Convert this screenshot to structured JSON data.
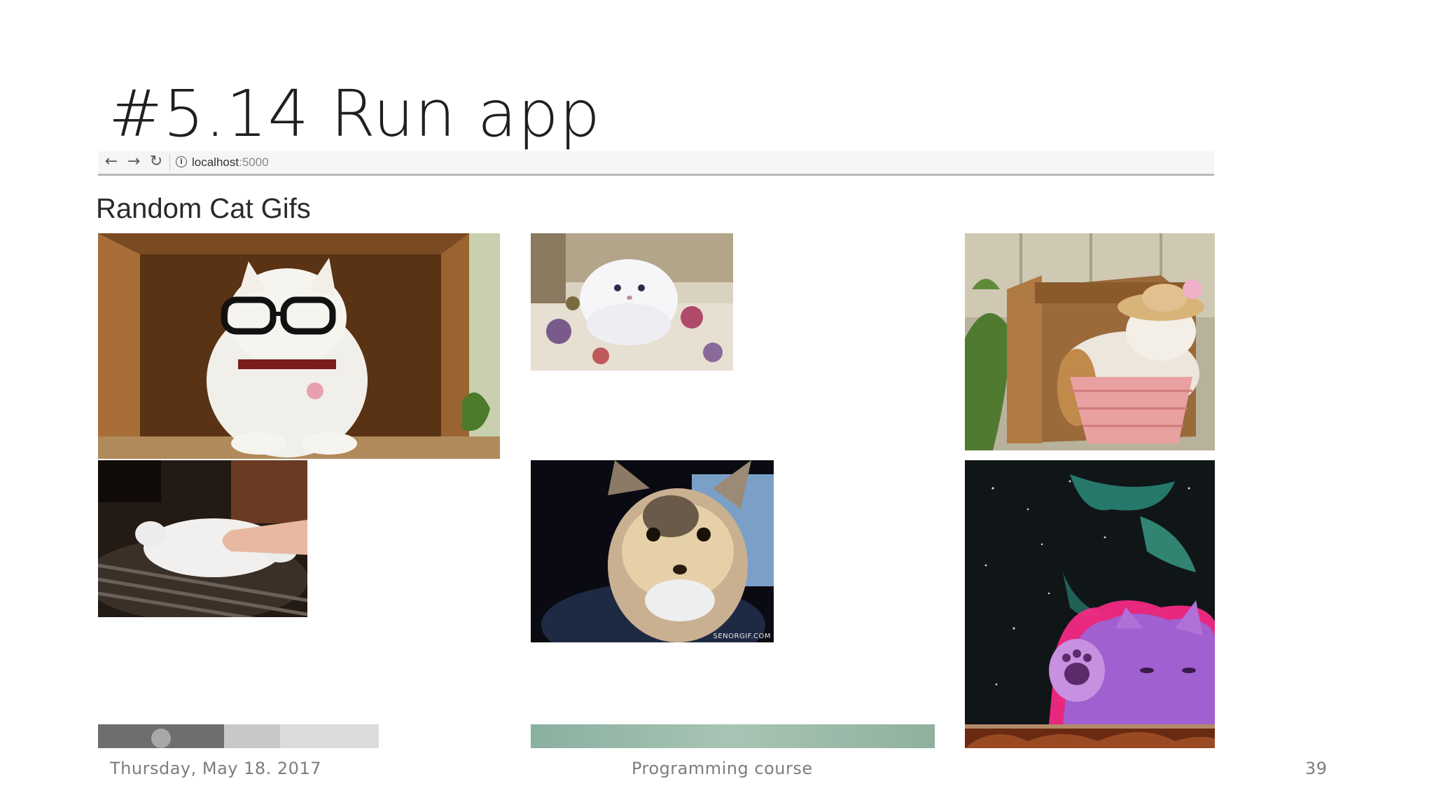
{
  "slide": {
    "title": "#5.14 Run app"
  },
  "browser": {
    "back_icon": "arrow-left",
    "forward_icon": "arrow-right",
    "reload_icon": "reload",
    "info_icon": "info-circle",
    "url_host": "localhost",
    "url_port": ":5000"
  },
  "page": {
    "heading": "Random Cat Gifs",
    "gifs": [
      {
        "subject": "white cat with glasses in cardboard box"
      },
      {
        "subject": "white fluffy kitten on floral blanket"
      },
      {
        "subject": "cat in pink basket with straw hat"
      },
      {
        "subject": "white cat lying on back being petted"
      },
      {
        "subject": "kitten close-up",
        "watermark": "SENORGIF.COM"
      },
      {
        "subject": "space cat in purple glow"
      }
    ]
  },
  "footer": {
    "date": "Thursday, May 18. 2017",
    "course": "Programming course",
    "page_number": "39"
  },
  "colors": {
    "title": "#1f1f1f",
    "footer": "#7d7d7d",
    "divider": "#b9b9b9"
  }
}
